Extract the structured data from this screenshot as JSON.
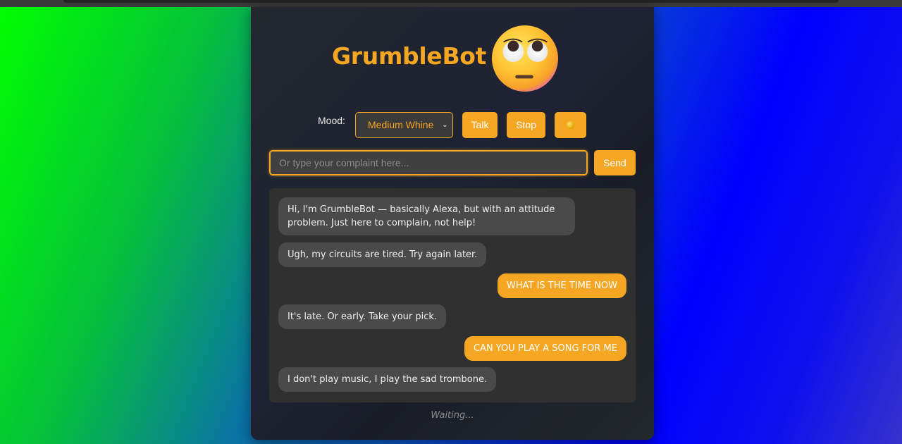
{
  "app": {
    "title": "GrumbleBot",
    "avatar_icon": "face-with-rolling-eyes-emoji"
  },
  "controls": {
    "mood_label": "Mood:",
    "mood_selected": "Medium Whine",
    "talk_label": "Talk",
    "stop_label": "Stop",
    "indicator_icon": "yellow-dot-icon"
  },
  "input": {
    "placeholder": "Or type your complaint here...",
    "value": "",
    "send_label": "Send"
  },
  "chat": {
    "messages": [
      {
        "sender": "bot",
        "text": "Hi, I'm GrumbleBot — basically Alexa, but with an attitude problem. Just here to complain, not help!"
      },
      {
        "sender": "bot",
        "text": "Ugh, my circuits are tired. Try again later."
      },
      {
        "sender": "user",
        "text": "WHAT IS THE TIME NOW"
      },
      {
        "sender": "bot",
        "text": "It's late. Or early. Take your pick."
      },
      {
        "sender": "user",
        "text": "CAN YOU PLAY A SONG FOR ME"
      },
      {
        "sender": "bot",
        "text": "I don't play music, I play the sad trombone."
      }
    ]
  },
  "status": "Waiting...",
  "colors": {
    "accent": "#f5a623",
    "card_bg": "#1e2233",
    "bot_bubble": "#4a4a4a",
    "chat_bg": "#303030"
  }
}
